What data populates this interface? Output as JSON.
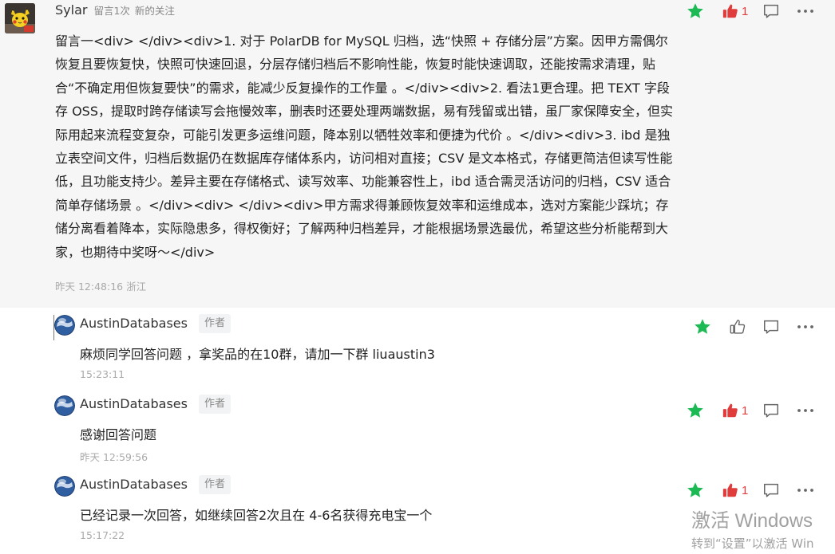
{
  "main_comment": {
    "author": "Sylar",
    "comment_count": "留言1次",
    "follow_label": "新的关注",
    "content": "留言一<div> </div><div>1. 对于 PolarDB for MySQL 归档，选“快照 + 存储分层”方案。因甲方需偶尔恢复且要恢复快，快照可快速回退，分层存储归档后不影响性能，恢复时能快速调取，还能按需求清理，贴合“不确定用但恢复要快”的需求，能减少反复操作的工作量 。</div><div>2. 看法1更合理。把 TEXT 字段存 OSS，提取时跨存储读写会拖慢效率，删表时还要处理两端数据，易有残留或出错，虽厂家保障安全，但实际用起来流程变复杂，可能引发更多运维问题，降本别以牺牲效率和便捷为代价 。</div><div>3. ibd 是独立表空间文件，归档后数据仍在数据库存储体系内，访问相对直接；CSV 是文本格式，存储更简洁但读写性能低，且功能支持少。差异主要在存储格式、读写效率、功能兼容性上，ibd 适合需灵活访问的归档，CSV 适合简单存储场景 。</div><div> </div><div>甲方需求得兼顾恢复效率和运维成本，选对方案能少踩坑；存储分离看着降本，实际隐患多，得权衡好；了解两种归档差异，才能根据场景选最优，希望这些分析能帮到大家，也期待中奖呀～</div>",
    "timestamp": "昨天 12:48:16 浙江",
    "like_count": "1"
  },
  "replies": [
    {
      "author": "AustinDatabases",
      "badge": "作者",
      "content": "麻烦同学回答问题 ，拿奖品的在10群，请加一下群 liuaustin3",
      "timestamp": "15:23:11",
      "like_count": ""
    },
    {
      "author": "AustinDatabases",
      "badge": "作者",
      "content": "感谢回答问题",
      "timestamp": "昨天 12:59:56",
      "like_count": "1"
    },
    {
      "author": "AustinDatabases",
      "badge": "作者",
      "content": "已经记录一次回答，如继续回答2次且在 4-6名获得充电宝一个",
      "timestamp": "15:17:22",
      "like_count": "1"
    }
  ],
  "watermark": {
    "title": "激活 Windows",
    "subtitle": "转到“设置”以激活 Win"
  },
  "colors": {
    "star": "#1db954",
    "like_active": "#e03c3c",
    "icon_gray": "#666666",
    "background_main": "#f6f6f7"
  }
}
